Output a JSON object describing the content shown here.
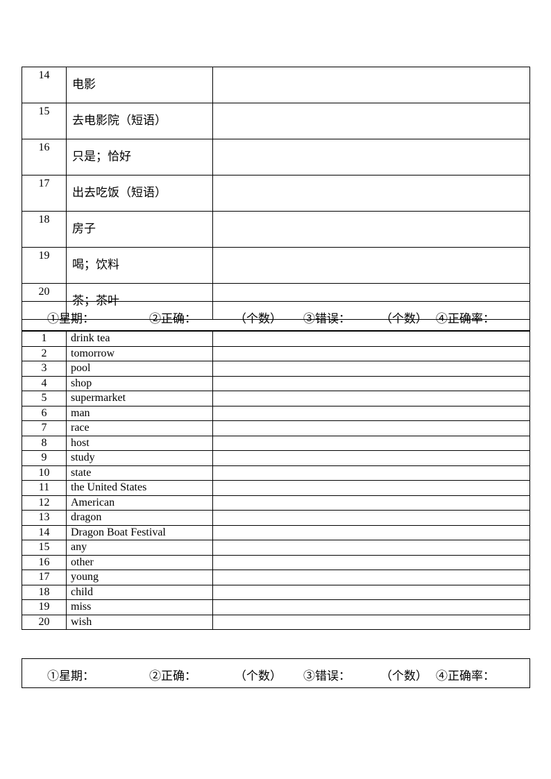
{
  "table_chinese": {
    "rows": [
      {
        "num": "14",
        "word": "电影",
        "answer": ""
      },
      {
        "num": "15",
        "word": "去电影院（短语）",
        "answer": ""
      },
      {
        "num": "16",
        "word": "只是；恰好",
        "answer": ""
      },
      {
        "num": "17",
        "word": "出去吃饭（短语）",
        "answer": ""
      },
      {
        "num": "18",
        "word": "房子",
        "answer": ""
      },
      {
        "num": "19",
        "word": "喝；饮料",
        "answer": ""
      },
      {
        "num": "20",
        "word": "茶；茶叶",
        "answer": ""
      }
    ]
  },
  "score_header": {
    "weekday": "①星期：",
    "correct": "②正确：",
    "count1": "（个数）",
    "wrong": "③错误：",
    "count2": "（个数）",
    "accuracy": "④正确率："
  },
  "table_english": {
    "rows": [
      {
        "num": "1",
        "word": "drink tea",
        "answer": ""
      },
      {
        "num": "2",
        "word": "tomorrow",
        "answer": ""
      },
      {
        "num": "3",
        "word": "pool",
        "answer": ""
      },
      {
        "num": "4",
        "word": "shop",
        "answer": ""
      },
      {
        "num": "5",
        "word": "supermarket",
        "answer": ""
      },
      {
        "num": "6",
        "word": "man",
        "answer": ""
      },
      {
        "num": "7",
        "word": "race",
        "answer": ""
      },
      {
        "num": "8",
        "word": "host",
        "answer": ""
      },
      {
        "num": "9",
        "word": "study",
        "answer": ""
      },
      {
        "num": "10",
        "word": "state",
        "answer": ""
      },
      {
        "num": "11",
        "word": "the United States",
        "answer": ""
      },
      {
        "num": "12",
        "word": "American",
        "answer": ""
      },
      {
        "num": "13",
        "word": "dragon",
        "answer": ""
      },
      {
        "num": "14",
        "word": "Dragon Boat Festival",
        "answer": ""
      },
      {
        "num": "15",
        "word": "any",
        "answer": ""
      },
      {
        "num": "16",
        "word": "other",
        "answer": ""
      },
      {
        "num": "17",
        "word": "young",
        "answer": ""
      },
      {
        "num": "18",
        "word": "child",
        "answer": ""
      },
      {
        "num": "19",
        "word": "miss",
        "answer": ""
      },
      {
        "num": "20",
        "word": "wish",
        "answer": ""
      }
    ]
  }
}
